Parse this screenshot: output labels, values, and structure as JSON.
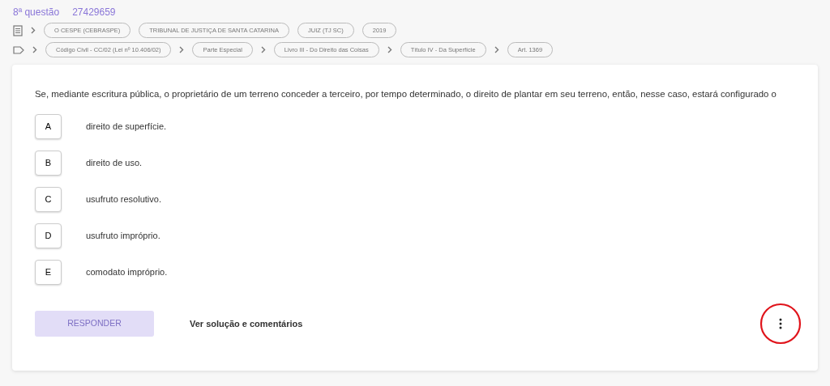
{
  "header": {
    "question_number": "8ª questão",
    "question_id": "27429659"
  },
  "info_tags": [
    "O CESPE (CEBRASPE)",
    "TRIBUNAL DE JUSTIÇA DE SANTA CATARINA",
    "JUIZ (TJ SC)",
    "2019"
  ],
  "subject_path": [
    "Código Civil - CC/02 (Lei nº 10.406/02)",
    "Parte Especial",
    "Livro III - Do Direito das Coisas",
    "Título IV - Da Superfície",
    "Art. 1369"
  ],
  "question": {
    "statement": "Se, mediante escritura pública, o proprietário de um terreno conceder a terceiro, por tempo determinado, o direito de plantar em seu terreno, então, nesse caso, estará configurado o",
    "options": [
      {
        "letter": "A",
        "text": "direito de superfície.",
        "selected": false
      },
      {
        "letter": "B",
        "text": "direito de uso.",
        "selected": false
      },
      {
        "letter": "C",
        "text": "usufruto resolutivo.",
        "selected": false
      },
      {
        "letter": "D",
        "text": "usufruto impróprio.",
        "selected": false
      },
      {
        "letter": "E",
        "text": "comodato impróprio.",
        "selected": false
      }
    ]
  },
  "actions": {
    "answer_button": {
      "label": "RESPONDER",
      "disabled": true
    },
    "solution_link": "Ver solução e comentários",
    "more_menu_highlighted": true
  }
}
